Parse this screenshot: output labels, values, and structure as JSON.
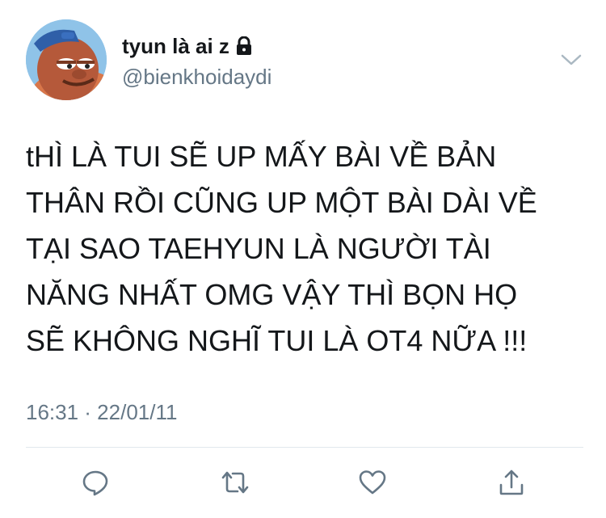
{
  "profile": {
    "display_name": "tyun là ai z",
    "handle": "@bienkhoidaydi",
    "protected_icon": "lock-icon",
    "avatar": "cartoon-avatar"
  },
  "tweet": {
    "text_lines": [
      "tHÌ LÀ TUI SẼ UP MẤY BÀI VỀ BẢN",
      "THÂN RỒI CŨNG UP MỘT BÀI DÀI VỀ",
      "TẠI SAO TAEHYUN LÀ NGƯỜI TÀI",
      "NĂNG NHẤT OMG VẬY THÌ BỌN HỌ",
      "SẼ KHÔNG NGHĨ TUI LÀ OT4 NỮA !!!"
    ],
    "timestamp": "16:31 · 22/01/11"
  },
  "actions": [
    {
      "name": "reply",
      "icon": "reply-icon"
    },
    {
      "name": "retweet",
      "icon": "retweet-icon"
    },
    {
      "name": "like",
      "icon": "heart-icon"
    },
    {
      "name": "share",
      "icon": "share-icon"
    }
  ],
  "colors": {
    "text": "#14171a",
    "secondary": "#657786",
    "divider": "#e1e8ed"
  }
}
